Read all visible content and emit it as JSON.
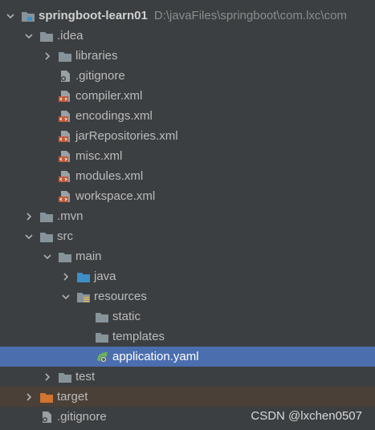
{
  "project": {
    "name": "springboot-learn01",
    "path": "D:\\javaFiles\\springboot\\com.lxc\\com"
  },
  "tree": {
    "idea": ".idea",
    "libraries": "libraries",
    "idea_gitignore": ".gitignore",
    "compiler": "compiler.xml",
    "encodings": "encodings.xml",
    "jarRepositories": "jarRepositories.xml",
    "misc": "misc.xml",
    "modules": "modules.xml",
    "workspace": "workspace.xml",
    "mvn": ".mvn",
    "src": "src",
    "main": "main",
    "java": "java",
    "resources": "resources",
    "static": "static",
    "templates": "templates",
    "application": "application.yaml",
    "test": "test",
    "target": "target",
    "root_gitignore": ".gitignore"
  },
  "watermark": "CSDN @lxchen0507",
  "colors": {
    "background": "#3c3f41",
    "selection": "#4b6eaf",
    "excluded_row": "#4a4037",
    "folder": "#87939a",
    "source_folder": "#3d8fc6",
    "excluded_folder": "#d0742f",
    "xml_icon": "#c25b3a"
  }
}
